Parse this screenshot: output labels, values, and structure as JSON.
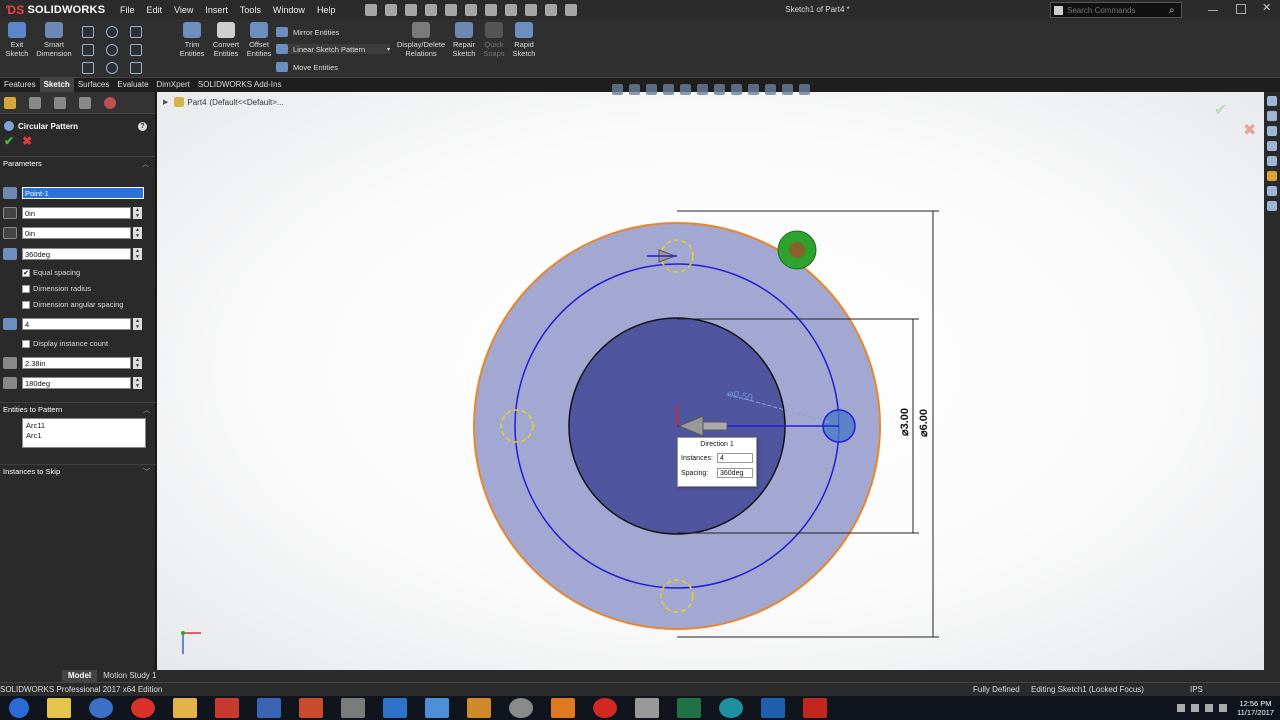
{
  "app": {
    "brand": "SOLIDWORKS",
    "menus": [
      "File",
      "Edit",
      "View",
      "Insert",
      "Tools",
      "Window",
      "Help"
    ],
    "doc_title": "Sketch1 of Part4 *",
    "search_placeholder": "Search Commands"
  },
  "command_manager": {
    "exit_sketch": "Exit Sketch",
    "smart_dimension": "Smart Dimension",
    "trim_entities": "Trim Entities",
    "convert_entities": "Convert Entities",
    "offset_entities": "Offset Entities",
    "mirror_entities": "Mirror Entities",
    "linear_sketch_pattern": "Linear Sketch Pattern",
    "move_entities": "Move Entities",
    "display_delete_relations": "Display/Delete Relations",
    "repair_sketch": "Repair Sketch",
    "quick_snaps": "Quick Snaps",
    "rapid_sketch": "Rapid Sketch"
  },
  "tabs": [
    "Features",
    "Sketch",
    "Surfaces",
    "Evaluate",
    "DimXpert",
    "SOLIDWORKS Add-Ins"
  ],
  "active_tab": "Sketch",
  "property_manager": {
    "title": "Circular Pattern",
    "ok": "✔",
    "cancel": "✖",
    "parameters_header": "Parameters",
    "center_point": "Point-1",
    "x_value": "0in",
    "y_value": "0in",
    "angle": "360deg",
    "equal_spacing": "Equal spacing",
    "dimension_radius": "Dimension radius",
    "dimension_angular_spacing": "Dimension angular spacing",
    "instances": "4",
    "display_instance_count": "Display instance count",
    "radius": "2.38in",
    "arc_angle": "180deg",
    "entities_header": "Entities to Pattern",
    "entities": [
      "Arc11",
      "Arc1"
    ],
    "skip_header": "Instances to Skip"
  },
  "tree": {
    "part": "Part4",
    "config": "(Default<<Default>..."
  },
  "popup": {
    "direction": "Direction 1",
    "instances_label": "Instances:",
    "instances_value": "4",
    "spacing_label": "Spacing:",
    "spacing_value": "360deg"
  },
  "dimensions": {
    "inner": "⌀3.00",
    "outer": "⌀6.00",
    "hole": "⌀0.50"
  },
  "bottom_tabs": [
    "Model",
    "Motion Study 1"
  ],
  "status": {
    "edition": "SOLIDWORKS Professional 2017 x64 Edition",
    "defined": "Fully Defined",
    "editing": "Editing Sketch1 (Locked Focus)",
    "units": "IPS"
  },
  "clock": {
    "time": "12:56 PM",
    "date": "11/17/2017"
  },
  "colors": {
    "part_fill": "#a3a8d2",
    "inner_fill": "#4f569f",
    "edge_orange": "#e8862a",
    "sketch_blue": "#1f1fd6",
    "hole_yellow": "#e8d21f"
  }
}
